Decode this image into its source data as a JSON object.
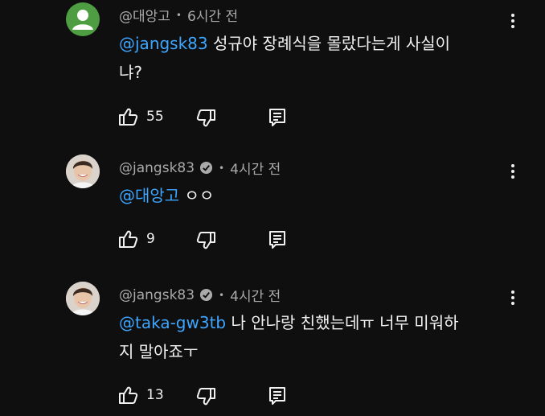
{
  "comments": [
    {
      "author": "@대앙고",
      "time": "6시간 전",
      "mention": "@jangsk83",
      "body_line1": " 성규야 장례식을 몰랐다는게 사실이",
      "body_line2": "냐?",
      "likes": "55"
    },
    {
      "author": "@jangsk83",
      "time": "4시간 전",
      "mention": "@대앙고",
      "body_line1": " ㅇㅇ",
      "likes": "9"
    },
    {
      "author": "@jangsk83",
      "time": "4시간 전",
      "mention": "@taka-gw3tb",
      "body_line1": " 나 안나랑 친했는데ㅠ 너무 미워하",
      "body_line2": "지 말아죠ㅜ",
      "likes": "13"
    }
  ],
  "colors": {
    "background": "#0f0f0f",
    "text": "#f1f1f1",
    "meta": "#aaaaaa",
    "mention": "#3ea6ff",
    "default_avatar": "#4f9d43"
  },
  "icons": [
    "like-icon",
    "dislike-icon",
    "reply-icon",
    "more-options-icon",
    "verified-icon"
  ]
}
